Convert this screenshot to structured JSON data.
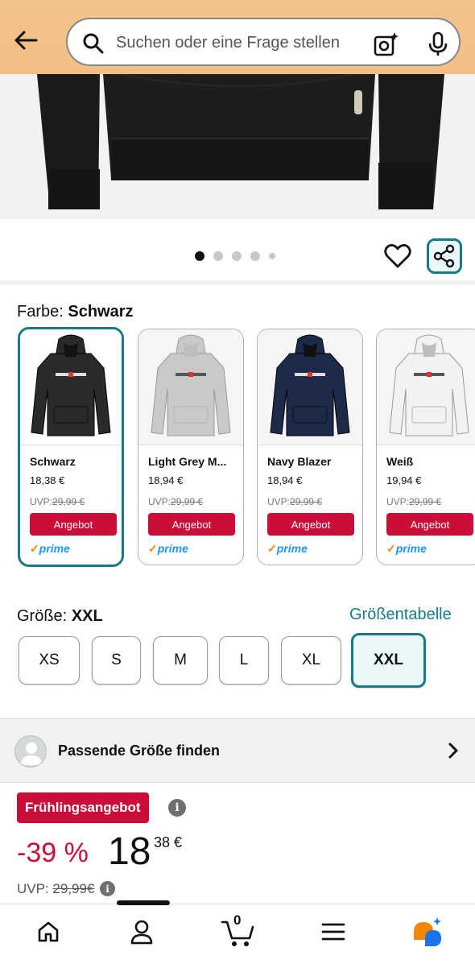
{
  "search": {
    "placeholder": "Suchen oder eine Frage stellen"
  },
  "carousel": {
    "image_count": 5,
    "active_index": 0
  },
  "color": {
    "label": "Farbe:",
    "selected": "Schwarz",
    "options": [
      {
        "name": "Schwarz",
        "price": "18,38 €",
        "uvp_label": "UVP:",
        "uvp": "29,99 €",
        "deal": "Angebot",
        "prime": "prime",
        "shirt_color": "#2a2a2a",
        "selected": true
      },
      {
        "name": "Light Grey M...",
        "price": "18,94 €",
        "uvp_label": "UVP:",
        "uvp": "29,99 €",
        "deal": "Angebot",
        "prime": "prime",
        "shirt_color": "#c9c9c9",
        "selected": false
      },
      {
        "name": "Navy Blazer",
        "price": "18,94 €",
        "uvp_label": "UVP:",
        "uvp": "29,99 €",
        "deal": "Angebot",
        "prime": "prime",
        "shirt_color": "#1e2a4a",
        "selected": false
      },
      {
        "name": "Weiß",
        "price": "19,94 €",
        "uvp_label": "UVP:",
        "uvp": "29,99 €",
        "deal": "Angebot",
        "prime": "prime",
        "shirt_color": "#f2f2f2",
        "selected": false
      }
    ]
  },
  "size": {
    "label": "Größe:",
    "selected": "XXL",
    "chart_link": "Größentabelle",
    "options": [
      "XS",
      "S",
      "M",
      "L",
      "XL",
      "XXL"
    ]
  },
  "find_size": {
    "label": "Passende Größe finden"
  },
  "deal": {
    "badge": "Frühlingsangebot",
    "discount": "-39 %",
    "price_whole": "18",
    "price_fraction": "38 €",
    "uvp_label": "UVP:",
    "uvp_value": "29,99€"
  },
  "nav": {
    "cart_count": "0"
  },
  "colors": {
    "accent": "#157a8a",
    "deal_red": "#cc0c39",
    "header_bg": "#f3c48a",
    "prime_blue": "#1a98ff"
  }
}
